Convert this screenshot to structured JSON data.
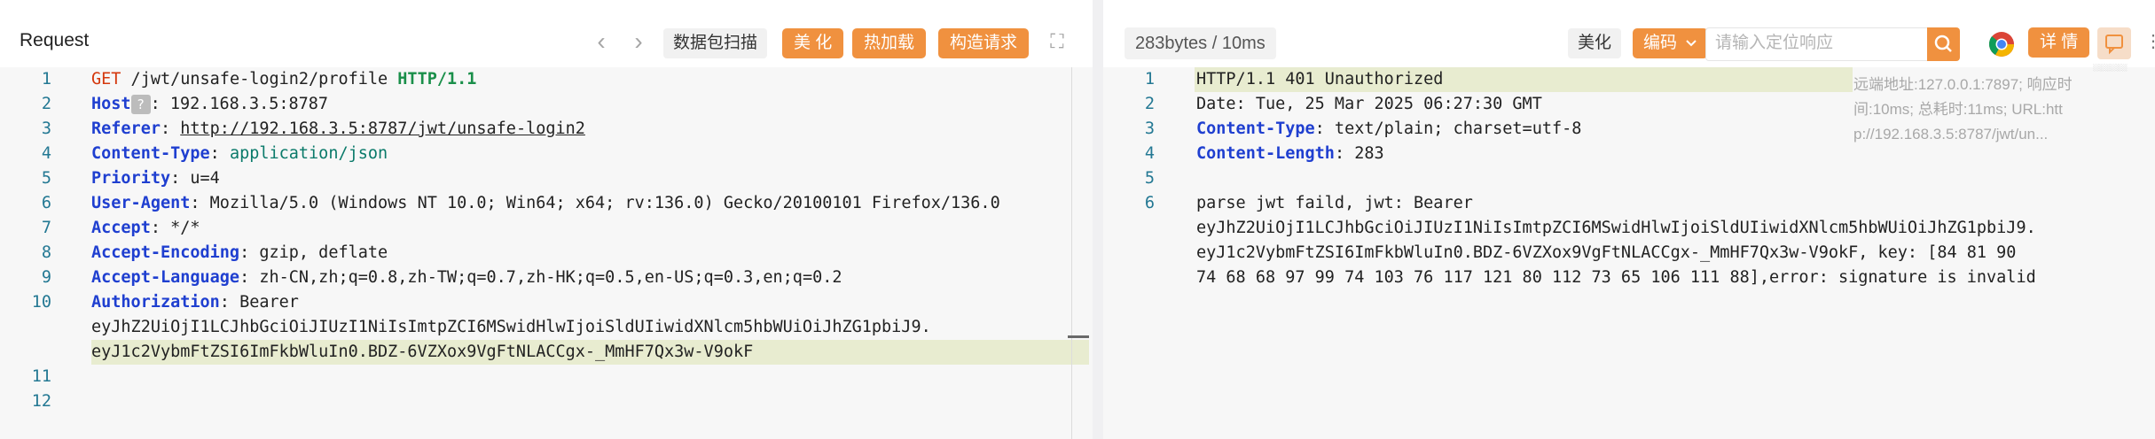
{
  "request": {
    "title": "Request",
    "toolbar": {
      "prev_icon": "‹",
      "next_icon": "›",
      "scan_label": "数据包扫描",
      "beautify_label": "美 化",
      "hotload_label": "热加载",
      "construct_label": "构造请求",
      "fullscreen_icon": "⛶"
    },
    "lines": [
      {
        "n": "1",
        "segs": [
          {
            "t": "GET",
            "c": "m"
          },
          {
            "t": " /jwt/unsafe-login2/profile "
          },
          {
            "t": "HTTP/1.1",
            "c": "g"
          }
        ]
      },
      {
        "n": "2",
        "segs": [
          {
            "t": "Host",
            "c": "k"
          },
          {
            "t": "?",
            "c": "qm"
          },
          {
            "t": ": 192.168.3.5:8787"
          }
        ]
      },
      {
        "n": "3",
        "segs": [
          {
            "t": "Referer",
            "c": "k"
          },
          {
            "t": ": "
          },
          {
            "t": "http://192.168.3.5:8787/jwt/unsafe-login2",
            "c": "u"
          }
        ]
      },
      {
        "n": "4",
        "segs": [
          {
            "t": "Content-Type",
            "c": "k"
          },
          {
            "t": ": "
          },
          {
            "t": "application/json",
            "c": "v"
          }
        ]
      },
      {
        "n": "5",
        "segs": [
          {
            "t": "Priority",
            "c": "k"
          },
          {
            "t": ": u=4"
          }
        ]
      },
      {
        "n": "6",
        "segs": [
          {
            "t": "User-Agent",
            "c": "k"
          },
          {
            "t": ": Mozilla/5.0 (Windows NT 10.0; Win64; x64; rv:136.0) Gecko/20100101 Firefox/136.0"
          }
        ]
      },
      {
        "n": "7",
        "segs": [
          {
            "t": "Accept",
            "c": "k"
          },
          {
            "t": ": */*"
          }
        ]
      },
      {
        "n": "8",
        "segs": [
          {
            "t": "Accept-Encoding",
            "c": "k"
          },
          {
            "t": ": gzip, deflate"
          }
        ]
      },
      {
        "n": "9",
        "segs": [
          {
            "t": "Accept-Language",
            "c": "k"
          },
          {
            "t": ": zh-CN,zh;q=0.8,zh-TW;q=0.7,zh-HK;q=0.5,en-US;q=0.3,en;q=0.2"
          }
        ]
      },
      {
        "n": "10",
        "segs": [
          {
            "t": "Authorization",
            "c": "k"
          },
          {
            "t": ": Bearer"
          }
        ]
      },
      {
        "n": "",
        "segs": [
          {
            "t": "eyJhZ2UiOjI1LCJhbGciOiJIUzI1NiIsImtpZCI6MSwidHlwIjoiSldUIiwidXNlcm5hbWUiOiJhZG1pbiJ9."
          }
        ]
      },
      {
        "n": "",
        "hl": true,
        "segs": [
          {
            "t": "eyJ1c2VybmFtZSI6ImFkbWluIn0.BDZ-6VZXox9VgFtNLACCgx-_MmHF7Qx3w-V9okF"
          }
        ]
      },
      {
        "n": "11",
        "segs": []
      },
      {
        "n": "12",
        "segs": []
      }
    ]
  },
  "response": {
    "size_label": "283bytes / 10ms",
    "beautify_label": "美化",
    "encoding_label": "编码",
    "search_placeholder": "请输入定位响应",
    "detail_label": "详 情",
    "meta": [
      "远端地址:127.0.0.1:7897; 响应时",
      "间:10ms; 总耗时:11ms; URL:htt",
      "p://192.168.3.5:8787/jwt/un..."
    ],
    "ghost": "░░░░░░",
    "lines": [
      {
        "n": "1",
        "hl": true,
        "segs": [
          {
            "t": "HTTP/1.1 401 Unauthorized"
          }
        ]
      },
      {
        "n": "2",
        "segs": [
          {
            "t": "Date: Tue, 25 Mar 2025 06:27:30 GMT"
          }
        ]
      },
      {
        "n": "3",
        "segs": [
          {
            "t": "Content-Type",
            "c": "k"
          },
          {
            "t": ": text/plain; charset=utf-8"
          }
        ]
      },
      {
        "n": "4",
        "segs": [
          {
            "t": "Content-Length",
            "c": "k"
          },
          {
            "t": ": 283"
          }
        ]
      },
      {
        "n": "5",
        "segs": []
      },
      {
        "n": "6",
        "segs": [
          {
            "t": "parse jwt faild, jwt: Bearer"
          }
        ]
      },
      {
        "n": "",
        "segs": [
          {
            "t": "eyJhZ2UiOjI1LCJhbGciOiJIUzI1NiIsImtpZCI6MSwidHlwIjoiSldUIiwidXNlcm5hbWUiOiJhZG1pbiJ9."
          }
        ]
      },
      {
        "n": "",
        "segs": [
          {
            "t": "eyJ1c2VybmFtZSI6ImFkbWluIn0.BDZ-6VZXox9VgFtNLACCgx-_MmHF7Qx3w-V9okF, key: [84 81 90"
          }
        ]
      },
      {
        "n": "",
        "segs": [
          {
            "t": "74 68 68 97 99 74 103 76 117 121 80 112 73 65 106 111 88],error: signature is invalid"
          }
        ]
      }
    ]
  },
  "colors": {
    "accent": "#f0913f",
    "keyword": "#1f3fd0",
    "method": "#d4380d",
    "version": "#1a8f4a",
    "line_number": "#237893",
    "highlight": "#e8ecd0"
  }
}
